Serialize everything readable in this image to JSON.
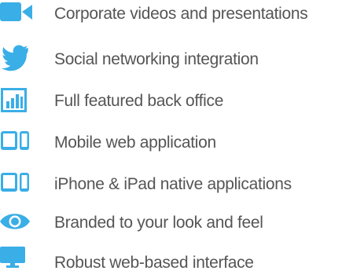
{
  "features": {
    "accent_color": "#3aaee6",
    "text_color": "#555555",
    "items": [
      {
        "label": "Corporate videos and presentations",
        "icon": "video-camera-icon"
      },
      {
        "label": "Social networking integration",
        "icon": "twitter-bird-icon"
      },
      {
        "label": "Full featured back office",
        "icon": "bar-chart-icon"
      },
      {
        "label": "Mobile web application",
        "icon": "tablet-phone-icon"
      },
      {
        "label": "iPhone & iPad native applications",
        "icon": "tablet-phone-icon"
      },
      {
        "label": "Branded to your look and feel",
        "icon": "eye-icon"
      },
      {
        "label": "Robust web-based interface",
        "icon": "desktop-monitor-icon"
      }
    ]
  }
}
